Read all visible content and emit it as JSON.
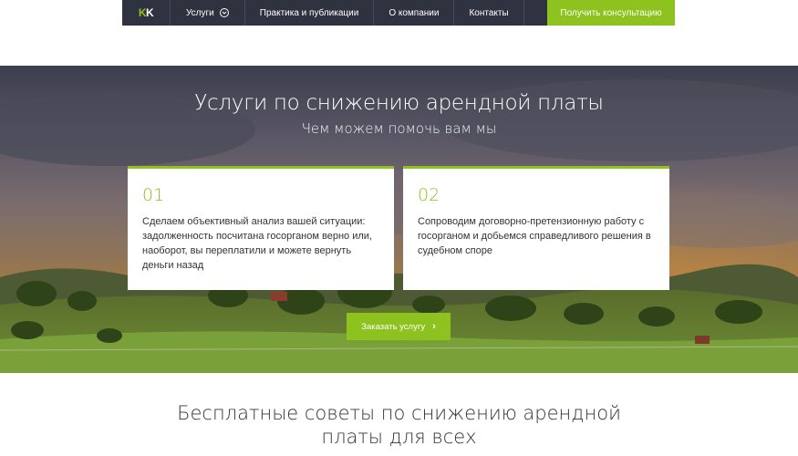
{
  "nav": {
    "logo_k1": "K",
    "logo_k2": "K",
    "items": [
      {
        "label": "Услуги"
      },
      {
        "label": "Практика и публикации"
      },
      {
        "label": "О компании"
      },
      {
        "label": "Контакты"
      }
    ],
    "cta_label": "Получить консультацию"
  },
  "hero": {
    "title": "Услуги по снижению арендной платы",
    "subtitle": "Чем можем помочь вам мы",
    "cards": [
      {
        "number": "01",
        "text": "Сделаем объективный анализ вашей ситуации: задолженность посчитана госорганом верно или, наоборот, вы переплатили и можете вернуть деньги назад"
      },
      {
        "number": "02",
        "text": "Сопроводим договорно-претензионную работу с госорганом и добьемся справедливого решения в судебном споре"
      }
    ],
    "button_label": "Заказать услугу",
    "button_arrow": "›"
  },
  "section": {
    "title_line1": "Бесплатные советы по снижению арендной",
    "title_line2": "платы для всех"
  },
  "colors": {
    "accent": "#8dc21f",
    "nav_bg": "#2f3340"
  }
}
